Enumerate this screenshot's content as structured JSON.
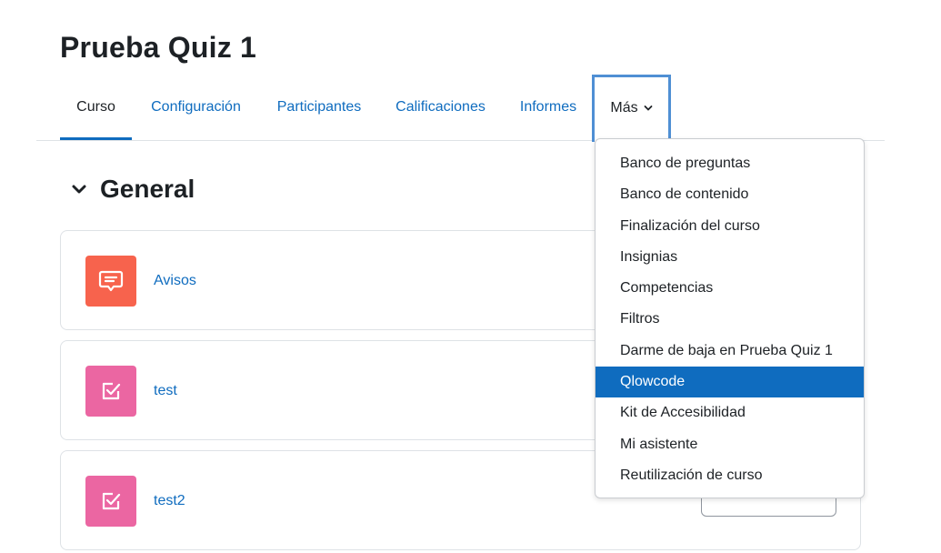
{
  "page": {
    "title": "Prueba Quiz 1"
  },
  "nav": {
    "tabs": [
      {
        "label": "Curso",
        "active": true
      },
      {
        "label": "Configuración"
      },
      {
        "label": "Participantes"
      },
      {
        "label": "Calificaciones"
      },
      {
        "label": "Informes"
      },
      {
        "label": "Más",
        "expanded": true
      }
    ]
  },
  "section": {
    "title": "General",
    "icon": "chevron-down-icon"
  },
  "activities": [
    {
      "name": "Avisos",
      "icon": "forum-icon",
      "color": "#f7634d"
    },
    {
      "name": "test",
      "icon": "quiz-icon",
      "color": "#eb66a2"
    },
    {
      "name": "test2",
      "icon": "quiz-icon",
      "color": "#eb66a2"
    }
  ],
  "more_menu": {
    "items": [
      "Banco de preguntas",
      "Banco de contenido",
      "Finalización del curso",
      "Insignias",
      "Competencias",
      "Filtros",
      "Darme de baja en Prueba Quiz 1",
      "Qlowcode",
      "Kit de Accesibilidad",
      "Mi asistente",
      "Reutilización de curso"
    ],
    "highlighted_index": 7
  },
  "colors": {
    "link": "#0f6cbf",
    "highlight": "#0f6cbf",
    "text": "#1d2125",
    "forum": "#f7634d",
    "quiz": "#eb66a2"
  }
}
